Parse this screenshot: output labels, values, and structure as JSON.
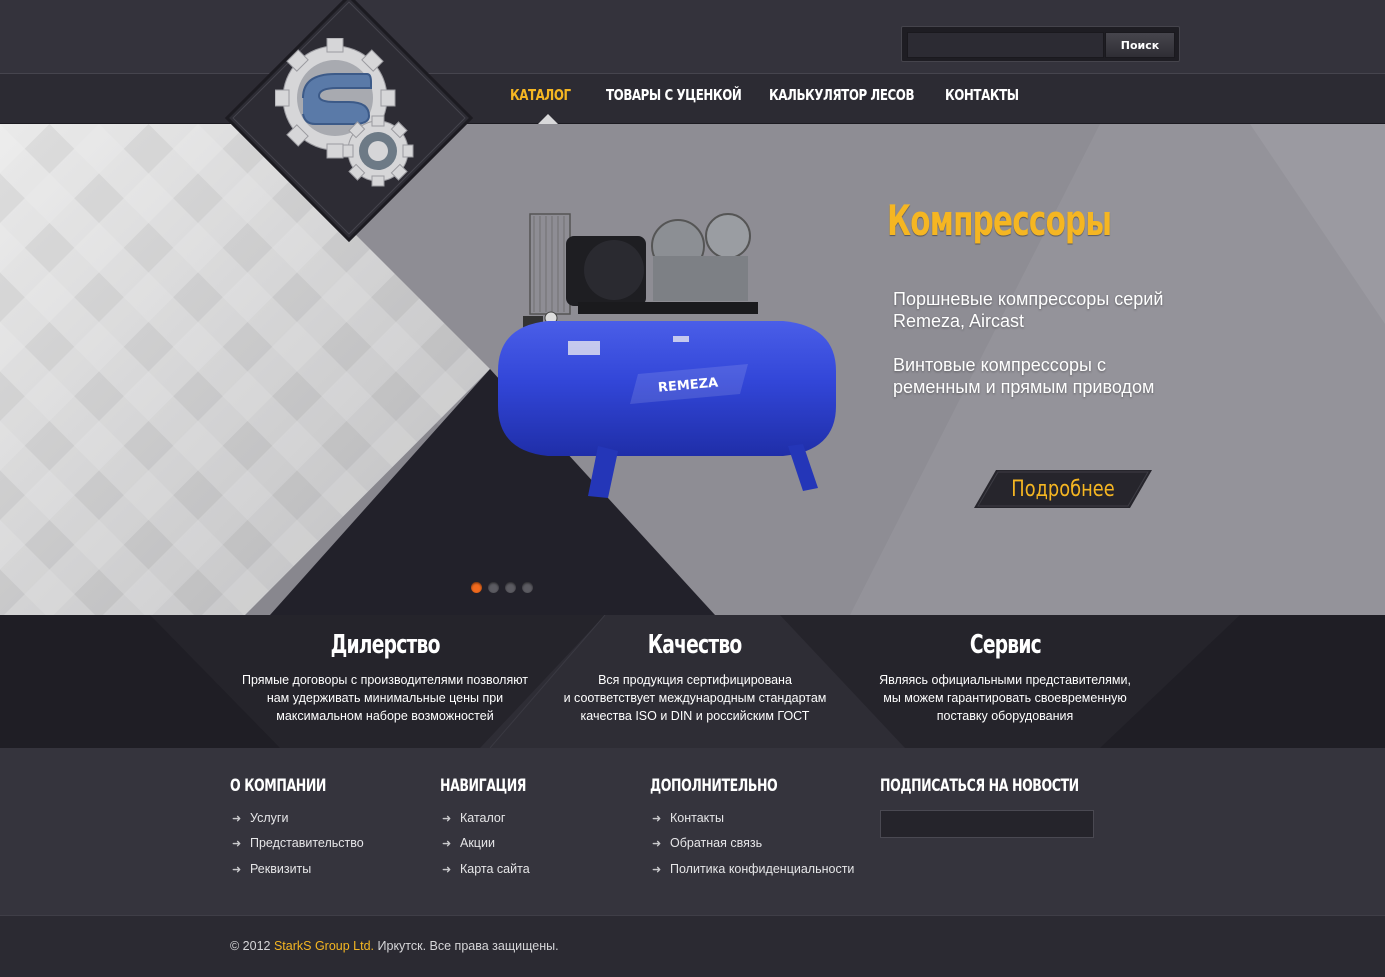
{
  "header": {
    "search": {
      "placeholder": "",
      "button_label": "Поиск"
    },
    "nav": [
      {
        "label": "Каталог",
        "active": true
      },
      {
        "label": "Товары с уценкой",
        "active": false
      },
      {
        "label": "Калькулятор лесов",
        "active": false
      },
      {
        "label": "Контакты",
        "active": false
      }
    ]
  },
  "slider": {
    "title": "Компрессоры",
    "lines": [
      "Поршневые компрессоры серий",
      "Remeza, Aircast",
      "Винтовые компрессоры с",
      "ременным и прямым приводом"
    ],
    "product_brand": "REMEZA",
    "button_label": "Подробнее",
    "dots": 4,
    "active_dot": 0
  },
  "features": [
    {
      "title": "Дилерство",
      "lines": [
        "Прямые договоры с производителями позволяют",
        "нам удерживать минимальные цены при",
        "максимальном наборе возможностей"
      ]
    },
    {
      "title": "Качество",
      "lines": [
        "Вся продукция сертифицирована",
        "и соответствует международным стандартам",
        "качества ISO и DIN и российским ГОСТ"
      ]
    },
    {
      "title": "Сервис",
      "lines": [
        "Являясь официальными представителями,",
        "мы можем гарантировать своевременную",
        "поставку оборудования"
      ]
    }
  ],
  "footer": {
    "columns": [
      {
        "title": "О компании",
        "links": [
          "Услуги",
          "Представительство",
          "Реквизиты"
        ]
      },
      {
        "title": "Навигация",
        "links": [
          "Каталог",
          "Акции",
          "Карта сайта"
        ]
      },
      {
        "title": "Дополнительно",
        "links": [
          "Контакты",
          "Обратная связь",
          "Политика конфиденциальности"
        ]
      }
    ],
    "subscribe": {
      "title": "Подписаться на новости",
      "placeholder": ""
    },
    "copyright": {
      "prefix": "© 2012 ",
      "company": "StarkS Group Ltd.",
      "suffix": " Иркутск. Все права защищены."
    }
  },
  "colors": {
    "accent": "#f5b622",
    "active_dot": "#f06a1e",
    "dark": "#1f1e25",
    "footer": "#35343d"
  }
}
